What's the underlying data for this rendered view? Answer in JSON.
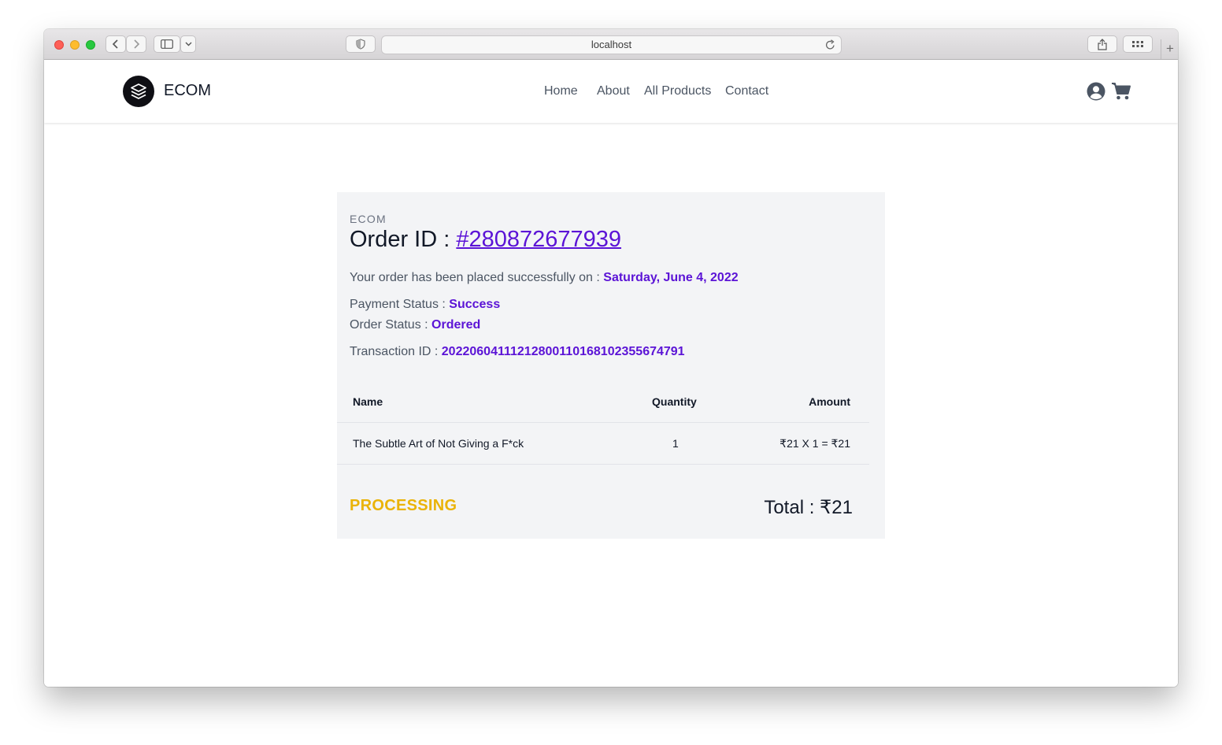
{
  "browser": {
    "url": "localhost"
  },
  "nav": {
    "brand": "ECOM",
    "links": [
      "Home",
      "About",
      "All Products",
      "Contact"
    ],
    "icons": [
      "user-circle-icon",
      "cart-icon"
    ]
  },
  "order": {
    "brand": "ECOM",
    "title_prefix": "Order ID : ",
    "id": "#280872677939",
    "placed_label": "Your order has been placed successfully on : ",
    "placed_date": "Saturday, June 4, 2022",
    "payment_label": "Payment Status : ",
    "payment_value": "Success",
    "status_label": "Order Status : ",
    "status_value": "Ordered",
    "txn_label": "Transaction ID : ",
    "txn_value": "20220604111212800110168102355674791",
    "table": {
      "headers": [
        "Name",
        "Quantity",
        "Amount"
      ],
      "rows": [
        {
          "name": "The Subtle Art of Not Giving a F*ck",
          "quantity": "1",
          "amount": "₹21 X 1 = ₹21"
        }
      ]
    },
    "badge": "PROCESSING",
    "total": "Total : ₹21"
  },
  "colors": {
    "accent": "#5b13d6",
    "processing": "#eab308",
    "card_bg": "#f3f4f6"
  }
}
